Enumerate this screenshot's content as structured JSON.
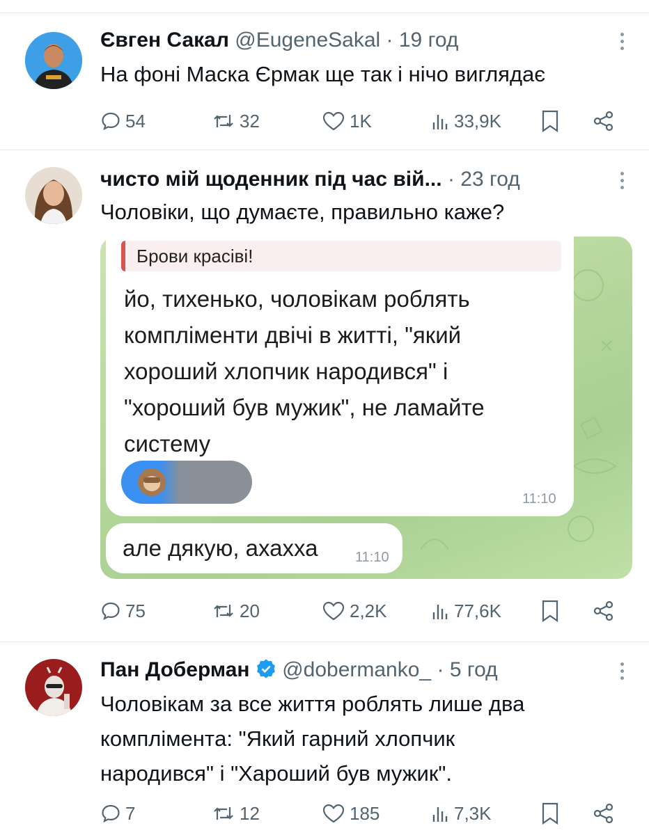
{
  "tweets": [
    {
      "name": "Євген Сакал",
      "handle": "@EugeneSakal",
      "time": "19 год",
      "text": "На фоні Маска Єрмак ще так і нічо виглядає",
      "replies": "54",
      "retweets": "32",
      "likes": "1K",
      "views": "33,9K"
    },
    {
      "name": "чисто мій щоденник під час вій...",
      "time": "23 год",
      "text": "Чоловіки, що думаєте, правильно каже?",
      "replies": "75",
      "retweets": "20",
      "likes": "2,2K",
      "views": "77,6K",
      "chat": {
        "reply_quote": "Брови красіві!",
        "message_lines": [
          "йо, тихенько, чоловікам роблять",
          "компліменти двічі в житті, \"який",
          "хороший хлопчик народився\" і",
          "\"хороший був мужик\", не ламайте",
          "систему"
        ],
        "message_time": "11:10",
        "second_message": "але дякую, ахахха",
        "second_time": "11:10"
      }
    },
    {
      "name": "Пан Доберман",
      "handle": "@dobermanko_",
      "time": "5 год",
      "text_lines": [
        "Чоловікам за все життя роблять лише два",
        "компліментa: \"Який гарний хлопчик",
        "народився\" і \"Хароший був мужик\"."
      ],
      "replies": "7",
      "retweets": "12",
      "likes": "185",
      "views": "7,3K"
    }
  ],
  "separator": "·",
  "colors": {
    "text": "#0f1419",
    "secondary": "#536471",
    "verified": "#1d9bf0",
    "divider": "#e6e9eb"
  }
}
